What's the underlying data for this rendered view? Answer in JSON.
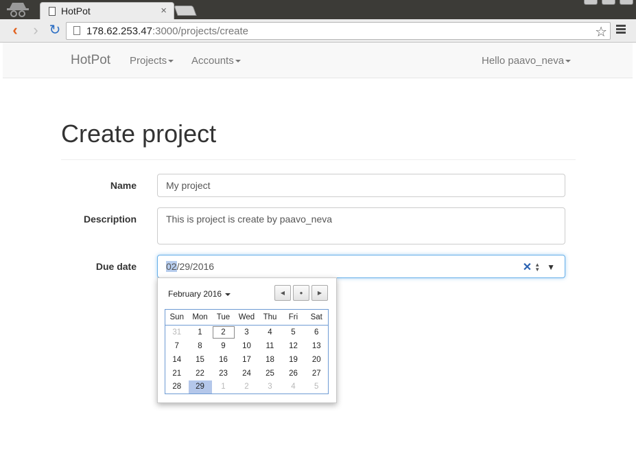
{
  "browser": {
    "tab_title": "HotPot",
    "tab_close": "×",
    "url_host": "178.62.253.47",
    "url_path": ":3000/projects/create"
  },
  "navbar": {
    "brand": "HotPot",
    "projects": "Projects",
    "accounts": "Accounts",
    "user": "Hello paavo_neva"
  },
  "page": {
    "title": "Create project"
  },
  "form": {
    "name_label": "Name",
    "name_value": "My project",
    "description_label": "Description",
    "description_value": "This is project is create by paavo_neva",
    "due_label": "Due date",
    "due_month": "02",
    "due_rest": "/29/2016"
  },
  "calendar": {
    "month_label": "February 2016",
    "weekdays": [
      "Sun",
      "Mon",
      "Tue",
      "Wed",
      "Thu",
      "Fri",
      "Sat"
    ],
    "weeks": [
      [
        "31",
        "1",
        "2",
        "3",
        "4",
        "5",
        "6"
      ],
      [
        "7",
        "8",
        "9",
        "10",
        "11",
        "12",
        "13"
      ],
      [
        "14",
        "15",
        "16",
        "17",
        "18",
        "19",
        "20"
      ],
      [
        "21",
        "22",
        "23",
        "24",
        "25",
        "26",
        "27"
      ],
      [
        "28",
        "29",
        "1",
        "2",
        "3",
        "4",
        "5"
      ]
    ]
  }
}
